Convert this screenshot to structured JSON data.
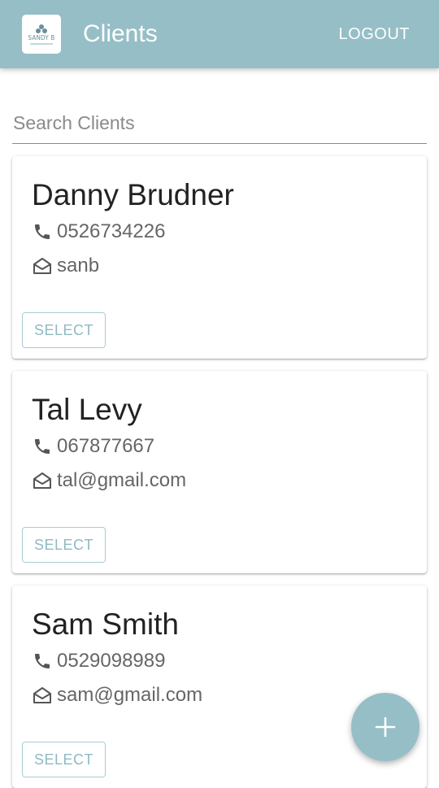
{
  "app": {
    "title": "Clients",
    "logout_label": "LOGOUT",
    "logo_text": "SANDY B"
  },
  "search": {
    "placeholder": "Search Clients",
    "value": ""
  },
  "clients": [
    {
      "name": "Danny Brudner",
      "phone": "0526734226",
      "email": "sanb",
      "select_label": "SELECT"
    },
    {
      "name": "Tal Levy",
      "phone": "067877667",
      "email": "tal@gmail.com",
      "select_label": "SELECT"
    },
    {
      "name": "Sam Smith",
      "phone": "0529098989",
      "email": "sam@gmail.com",
      "select_label": "SELECT"
    }
  ],
  "icons": {
    "phone": "phone-icon",
    "email": "envelope-open-icon",
    "add": "plus-icon"
  },
  "colors": {
    "primary": "#96bec6",
    "button_text": "#8fbac2"
  }
}
